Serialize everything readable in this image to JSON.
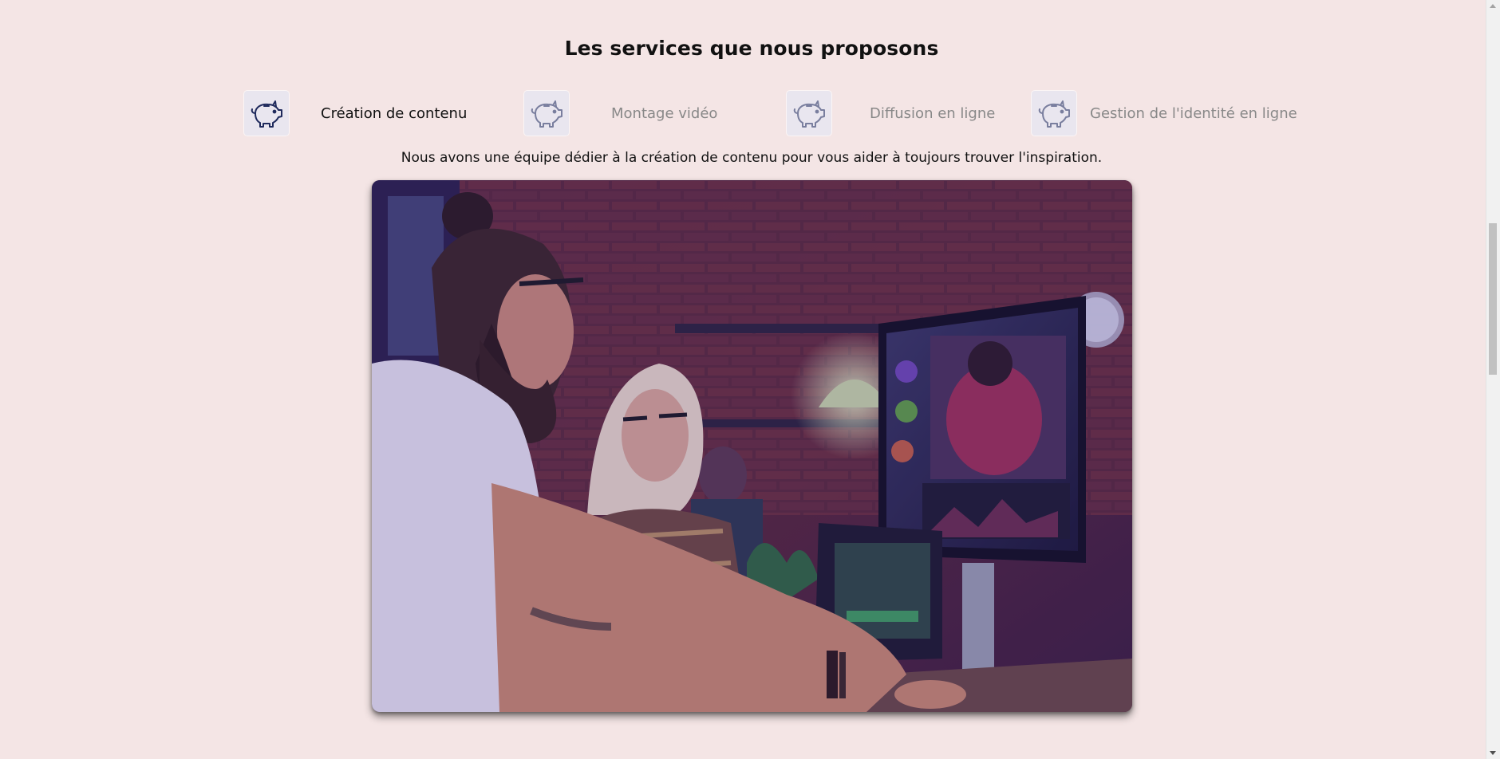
{
  "section": {
    "title": "Les services que nous proposons"
  },
  "tabs": [
    {
      "label": "Création de contenu",
      "icon": "piggy-bank-icon",
      "active": true
    },
    {
      "label": "Montage vidéo",
      "icon": "piggy-bank-icon",
      "active": false
    },
    {
      "label": "Diffusion en ligne",
      "icon": "piggy-bank-icon",
      "active": false
    },
    {
      "label": "Gestion de l'identité en ligne",
      "icon": "piggy-bank-icon",
      "active": false
    }
  ],
  "active_tab": {
    "description": "Nous avons une équipe dédier à la création de contenu pour vous aider à toujours trouver l'inspiration."
  },
  "colors": {
    "background": "#f4e5e5",
    "icon_stroke": "#1f2a5c",
    "icon_box": "#e9e6ef",
    "active_text": "#111111",
    "inactive_text": "#888888"
  }
}
